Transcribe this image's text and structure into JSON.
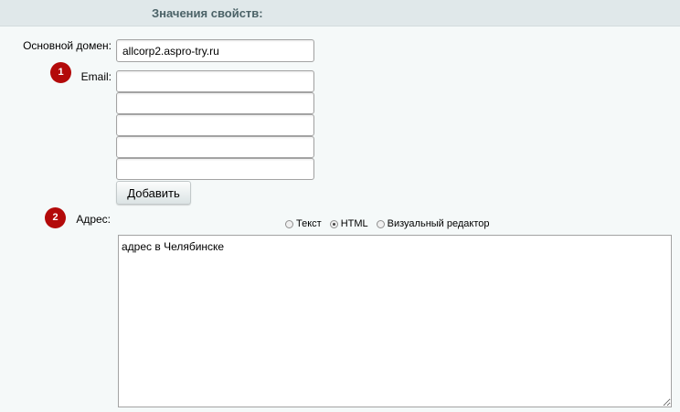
{
  "header": {
    "title": "Значения свойств:"
  },
  "fields": {
    "domain": {
      "label": "Основной домен:",
      "value": "allcorp2.aspro-try.ru"
    },
    "email": {
      "label": "Email:",
      "badge": "1",
      "values": [
        "",
        "",
        "",
        "",
        ""
      ],
      "add_button": "Добавить"
    },
    "address": {
      "label": "Адрес:",
      "badge": "2",
      "modes": [
        {
          "label": "Текст",
          "checked": false
        },
        {
          "label": "HTML",
          "checked": true
        },
        {
          "label": "Визуальный редактор",
          "checked": false
        }
      ],
      "value": "адрес в Челябинске"
    }
  }
}
